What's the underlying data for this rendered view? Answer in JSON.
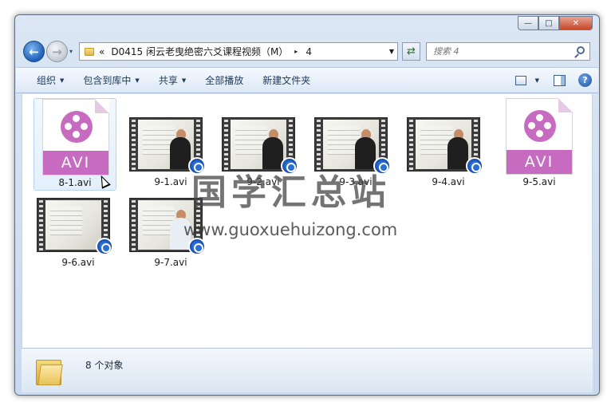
{
  "window": {
    "controls": {
      "minimize": "—",
      "maximize": "□",
      "close": "✕"
    }
  },
  "nav": {
    "back_glyph": "←",
    "forward_glyph": "→",
    "history_glyph": "▾",
    "address_chevron": "«",
    "address_path": "D0415 闲云老曳绝密六爻课程视频（M）",
    "address_sep": "▸",
    "address_leaf": "4",
    "address_drop": "▼",
    "refresh_glyph": "⇄",
    "search_placeholder": "搜索 4"
  },
  "toolbar": {
    "organize": "组织",
    "include_library": "包含到库中",
    "share": "共享",
    "play_all": "全部播放",
    "new_folder": "新建文件夹",
    "caret": "▼",
    "view_caret": "▼",
    "help_glyph": "?"
  },
  "files": [
    {
      "name": "8-1.avi",
      "kind": "avi-icon",
      "selected": true
    },
    {
      "name": "9-1.avi",
      "kind": "video-thumb"
    },
    {
      "name": "9-2.avi",
      "kind": "video-thumb"
    },
    {
      "name": "9-3.avi",
      "kind": "video-thumb"
    },
    {
      "name": "9-4.avi",
      "kind": "video-thumb"
    },
    {
      "name": "9-5.avi",
      "kind": "avi-icon"
    },
    {
      "name": "9-6.avi",
      "kind": "video-thumb"
    },
    {
      "name": "9-7.avi",
      "kind": "video-thumb"
    }
  ],
  "avi_label": "AVI",
  "details": {
    "count_text": "8 个对象"
  },
  "watermark": {
    "cn": "国学汇总站",
    "url": "www.guoxuehuizong.com"
  },
  "colors": {
    "avi_accent": "#c76bc0",
    "toolbar_text": "#1e395b",
    "badge": "#2a6fd6"
  }
}
